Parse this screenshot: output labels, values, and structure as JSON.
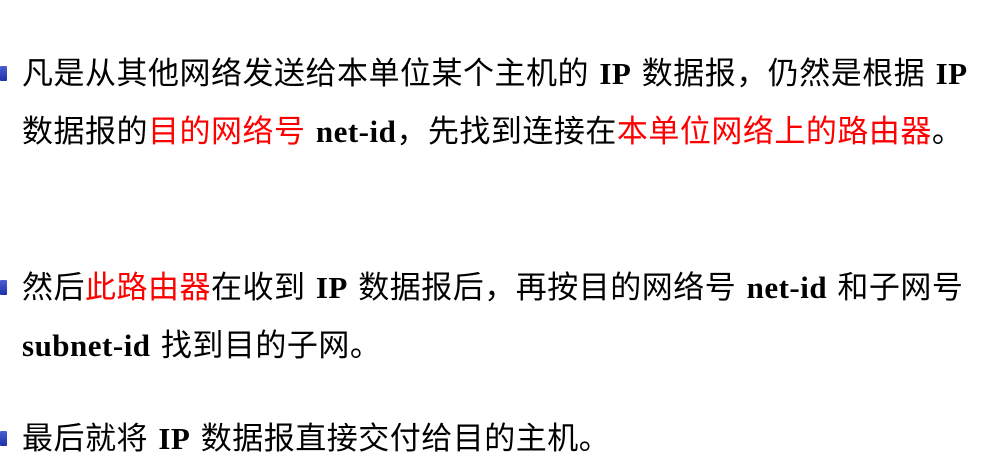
{
  "bullets": [
    {
      "id": "item-1",
      "segments": [
        {
          "text": "凡是从其他网络发送给本单位某个主机的 ",
          "style": "normal"
        },
        {
          "text": "IP",
          "style": "bold"
        },
        {
          "text": " 数据报，仍然是根据 ",
          "style": "normal"
        },
        {
          "text": "IP",
          "style": "bold"
        },
        {
          "text": " 数据报的",
          "style": "normal"
        },
        {
          "text": "目的网络号",
          "style": "red"
        },
        {
          "text": " ",
          "style": "normal"
        },
        {
          "text": "net-id",
          "style": "bold"
        },
        {
          "text": "，先找到连接在",
          "style": "normal"
        },
        {
          "text": "本单位网络上的路由器",
          "style": "red"
        },
        {
          "text": "。",
          "style": "normal"
        }
      ]
    },
    {
      "id": "item-2",
      "segments": [
        {
          "text": "然后",
          "style": "normal"
        },
        {
          "text": "此路由器",
          "style": "red"
        },
        {
          "text": "在收到 ",
          "style": "normal"
        },
        {
          "text": "IP",
          "style": "bold"
        },
        {
          "text": " 数据报后，再按目的网络号 ",
          "style": "normal"
        },
        {
          "text": "net-id",
          "style": "bold"
        },
        {
          "text": " 和子网号 ",
          "style": "normal"
        },
        {
          "text": "subnet-id",
          "style": "bold"
        },
        {
          "text": " 找到目的子网。",
          "style": "normal"
        }
      ]
    },
    {
      "id": "item-3",
      "segments": [
        {
          "text": "最后就将 ",
          "style": "normal"
        },
        {
          "text": "IP",
          "style": "bold"
        },
        {
          "text": " 数据报直接交付给目的主机。",
          "style": "normal"
        }
      ]
    }
  ],
  "colors": {
    "text": "#000000",
    "highlight": "#ff0000",
    "bullet": "#2a3cb8"
  }
}
